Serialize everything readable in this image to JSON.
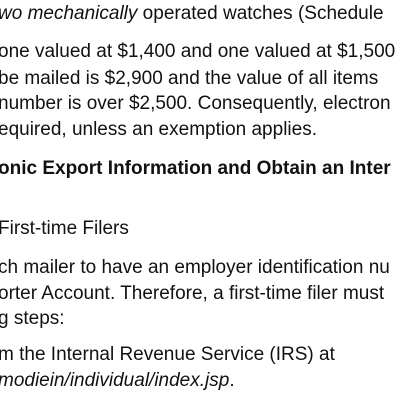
{
  "paragraph1": {
    "line1_italic": "wo mechanically",
    "line1_rest": " operated watches (Schedule",
    "line2": "one valued at $1,400 and one valued at $1,500",
    "line3": " be mailed is $2,900 and the value of all items",
    "line4": "number is over $2,500. Consequently, electron",
    "line5": "equired, unless an exemption applies."
  },
  "section_heading": "onic Export Information and Obtain an Inter",
  "subheading": "First-time Filers",
  "paragraph2": {
    "line1": "ch mailer to have an employer identification nu",
    "line2": "orter Account. Therefore, a first-time filer must",
    "line3": "g steps:"
  },
  "step1": {
    "line1": "m the Internal Revenue Service (IRS) at",
    "line2_italic": "modiein/individual/index.jsp",
    "line2_rest": "."
  }
}
